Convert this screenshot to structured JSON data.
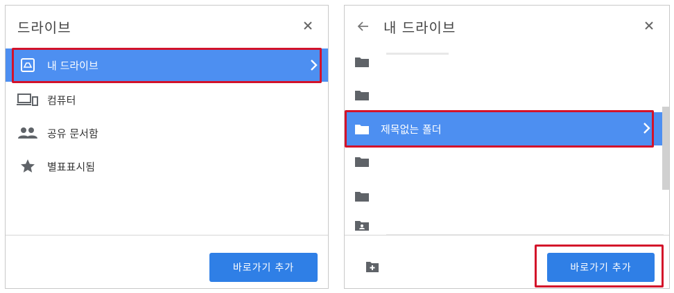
{
  "left_panel": {
    "title": "드라이브",
    "nav_items": [
      {
        "label": "내 드라이브",
        "icon": "drive-icon",
        "active": true
      },
      {
        "label": "컴퓨터",
        "icon": "computer-icon",
        "active": false
      },
      {
        "label": "공유 문서함",
        "icon": "people-icon",
        "active": false
      },
      {
        "label": "별표표시됨",
        "icon": "star-icon",
        "active": false
      }
    ],
    "add_shortcut_label": "바로가기 추가"
  },
  "right_panel": {
    "title": "내 드라이브",
    "folders": [
      {
        "label": "",
        "icon": "folder-icon",
        "active": false
      },
      {
        "label": "",
        "icon": "folder-icon",
        "active": false
      },
      {
        "label": "제목없는 폴더",
        "icon": "folder-icon",
        "active": true
      },
      {
        "label": "",
        "icon": "folder-icon",
        "active": false
      },
      {
        "label": "",
        "icon": "folder-icon",
        "active": false
      },
      {
        "label": "",
        "icon": "shared-folder-icon",
        "active": false
      }
    ],
    "add_shortcut_label": "바로가기 추가",
    "new_folder_icon": "new-folder-icon"
  },
  "colors": {
    "accent": "#4d8ff1",
    "button": "#2f7fe6",
    "highlight": "#d3122a",
    "icon_gray": "#5f6368"
  }
}
